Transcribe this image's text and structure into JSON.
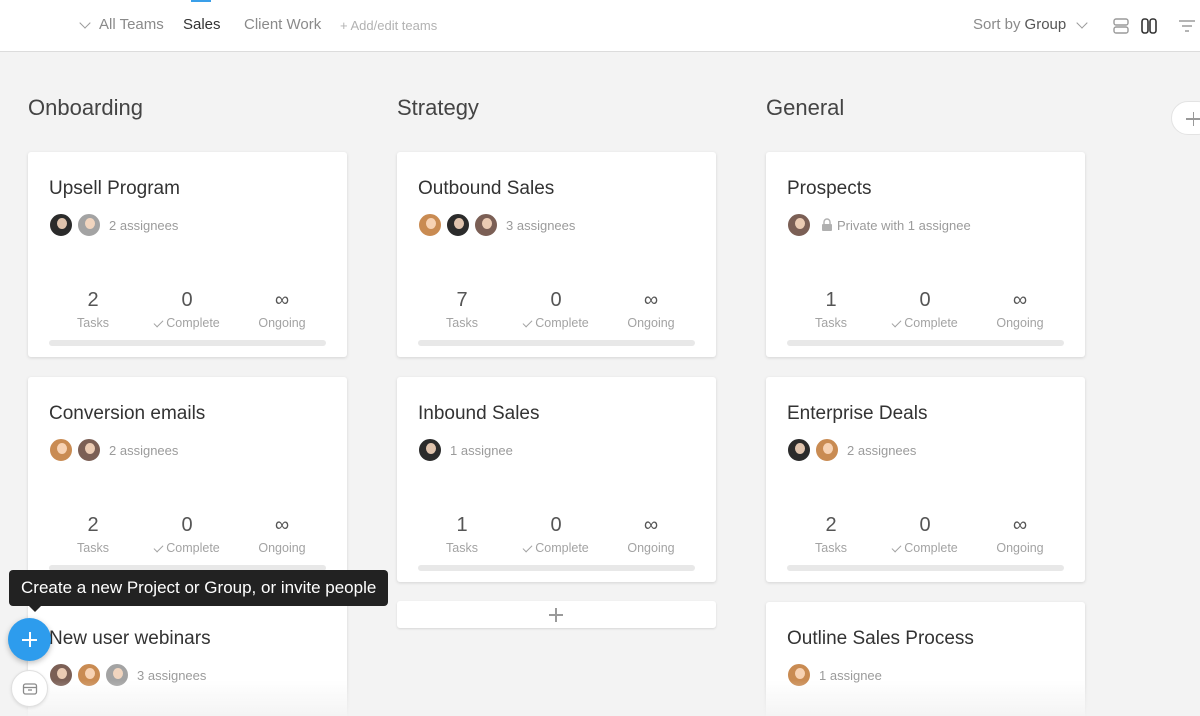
{
  "header": {
    "team_switcher": "All Teams",
    "tabs": [
      {
        "label": "Sales",
        "active": true
      },
      {
        "label": "Client Work",
        "active": false
      }
    ],
    "add_edit_teams": "+ Add/edit teams",
    "sort_label": "Sort by",
    "sort_value": "Group",
    "tool_icons": [
      "list-view-icon",
      "board-view-icon",
      "filter-icon"
    ]
  },
  "columns": [
    {
      "title": "Onboarding"
    },
    {
      "title": "Strategy"
    },
    {
      "title": "General"
    }
  ],
  "labels": {
    "tasks": "Tasks",
    "complete": "Complete",
    "ongoing": "Ongoing"
  },
  "cards": [
    {
      "title": "Upsell Program",
      "assignees": "2 assignees",
      "tasks": "2",
      "complete": "0",
      "ongoing": "∞"
    },
    {
      "title": "Conversion emails",
      "assignees": "2 assignees",
      "tasks": "2",
      "complete": "0",
      "ongoing": "∞"
    },
    {
      "title": "New user webinars",
      "assignees": "3 assignees"
    },
    {
      "title": "Outbound Sales",
      "assignees": "3 assignees",
      "tasks": "7",
      "complete": "0",
      "ongoing": "∞"
    },
    {
      "title": "Inbound Sales",
      "assignees": "1 assignee",
      "tasks": "1",
      "complete": "0",
      "ongoing": "∞"
    },
    {
      "title": "Prospects",
      "assignees": "Private with 1 assignee",
      "tasks": "1",
      "complete": "0",
      "ongoing": "∞"
    },
    {
      "title": "Enterprise Deals",
      "assignees": "2 assignees",
      "tasks": "2",
      "complete": "0",
      "ongoing": "∞"
    },
    {
      "title": "Outline Sales Process",
      "assignees": "1 assignee"
    }
  ],
  "tooltip": "Create a new Project or Group, or invite people",
  "colors": {
    "accent": "#2d9ced",
    "tab_indicator": "#3a9fe9",
    "tooltip_bg": "#222222"
  }
}
